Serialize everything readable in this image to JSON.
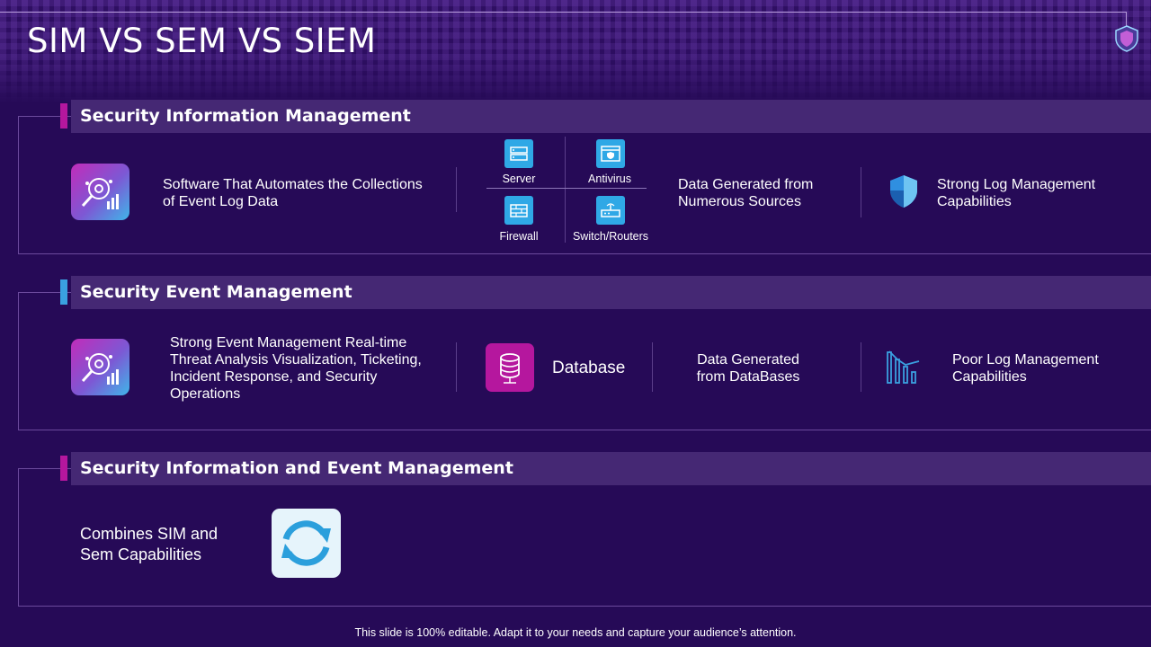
{
  "title": "SIM VS SEM VS SIEM",
  "colors": {
    "background": "#260a57",
    "header_bar": "#452874",
    "accent_magenta": "#b5179e",
    "accent_blue": "#3aa0e0"
  },
  "sections": [
    {
      "heading": "Security Information Management",
      "description": "Software That Automates the Collections of Event Log Data",
      "sources": [
        "Server",
        "Antivirus",
        "Firewall",
        "Switch/Routers"
      ],
      "data_text": "Data Generated from Numerous Sources",
      "capability": "Strong Log Management Capabilities",
      "capability_icon": "shield-icon"
    },
    {
      "heading": "Security Event Management",
      "description": "Strong Event Management Real-time Threat Analysis Visualization, Ticketing, Incident Response, and Security Operations",
      "source_label": "Database",
      "data_text": "Data Generated from DataBases",
      "capability": "Poor Log Management Capabilities",
      "capability_icon": "declining-chart-icon"
    },
    {
      "heading": "Security Information and Event Management",
      "description": "Combines SIM and Sem Capabilities",
      "icon": "refresh-icon"
    }
  ],
  "footer": "This slide is 100% editable. Adapt it to your needs and capture your audience’s attention."
}
